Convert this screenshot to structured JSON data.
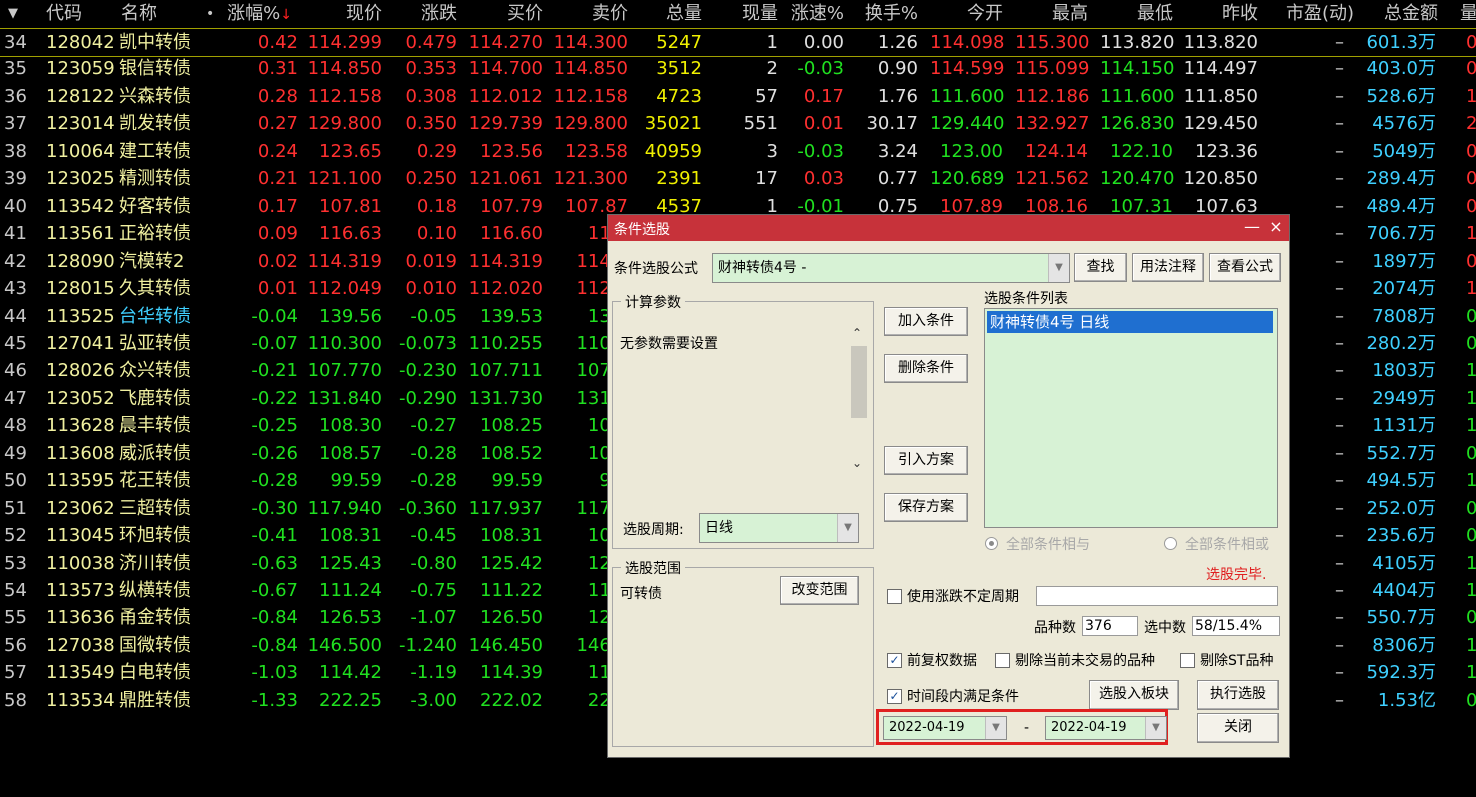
{
  "header": {
    "collapse_arrow": "▼",
    "code": "代码",
    "name": "名称",
    "dot": "•",
    "pct_change": "涨幅%",
    "sort_arrow": "↓",
    "price": "现价",
    "change": "涨跌",
    "bid": "买价",
    "ask": "卖价",
    "volume": "总量",
    "cur_volume": "现量",
    "speed": "涨速%",
    "turnover": "换手%",
    "open": "今开",
    "high": "最高",
    "low": "最低",
    "prev_close": "昨收",
    "pe": "市盈(动)",
    "amount": "总金额",
    "last_col": "量"
  },
  "rows": [
    {
      "idx": "34",
      "code": "128042",
      "name": "凯中转债",
      "pct": "0.42",
      "price": "114.299",
      "chg": "0.479",
      "bid": "114.270",
      "ask": "114.300",
      "vol": "5247",
      "cur": "1",
      "speed": "0.00",
      "turnover": "1.26",
      "open": "114.098",
      "high": "115.300",
      "low": "113.820",
      "prev": "113.820",
      "pe": "–",
      "amount": "601.3万",
      "tail": "0"
    },
    {
      "idx": "35",
      "code": "123059",
      "name": "银信转债",
      "pct": "0.31",
      "price": "114.850",
      "chg": "0.353",
      "bid": "114.700",
      "ask": "114.850",
      "vol": "3512",
      "cur": "2",
      "speed": "-0.03",
      "turnover": "0.90",
      "open": "114.599",
      "high": "115.099",
      "low": "114.150",
      "prev": "114.497",
      "pe": "–",
      "amount": "403.0万",
      "tail": "0"
    },
    {
      "idx": "36",
      "code": "128122",
      "name": "兴森转债",
      "pct": "0.28",
      "price": "112.158",
      "chg": "0.308",
      "bid": "112.012",
      "ask": "112.158",
      "vol": "4723",
      "cur": "57",
      "speed": "0.17",
      "turnover": "1.76",
      "open": "111.600",
      "high": "112.186",
      "low": "111.600",
      "prev": "111.850",
      "pe": "–",
      "amount": "528.6万",
      "tail": "1"
    },
    {
      "idx": "37",
      "code": "123014",
      "name": "凯发转债",
      "pct": "0.27",
      "price": "129.800",
      "chg": "0.350",
      "bid": "129.739",
      "ask": "129.800",
      "vol": "35021",
      "cur": "551",
      "speed": "0.01",
      "turnover": "30.17",
      "open": "129.440",
      "high": "132.927",
      "low": "126.830",
      "prev": "129.450",
      "pe": "–",
      "amount": "4576万",
      "tail": "2"
    },
    {
      "idx": "38",
      "code": "110064",
      "name": "建工转债",
      "pct": "0.24",
      "price": "123.65",
      "chg": "0.29",
      "bid": "123.56",
      "ask": "123.58",
      "vol": "40959",
      "cur": "3",
      "speed": "-0.03",
      "turnover": "3.24",
      "open": "123.00",
      "high": "124.14",
      "low": "122.10",
      "prev": "123.36",
      "pe": "–",
      "amount": "5049万",
      "tail": "0"
    },
    {
      "idx": "39",
      "code": "123025",
      "name": "精测转债",
      "pct": "0.21",
      "price": "121.100",
      "chg": "0.250",
      "bid": "121.061",
      "ask": "121.300",
      "vol": "2391",
      "cur": "17",
      "speed": "0.03",
      "turnover": "0.77",
      "open": "120.689",
      "high": "121.562",
      "low": "120.470",
      "prev": "120.850",
      "pe": "–",
      "amount": "289.4万",
      "tail": "0"
    },
    {
      "idx": "40",
      "code": "113542",
      "name": "好客转债",
      "pct": "0.17",
      "price": "107.81",
      "chg": "0.18",
      "bid": "107.79",
      "ask": "107.87",
      "vol": "4537",
      "cur": "1",
      "speed": "-0.01",
      "turnover": "0.75",
      "open": "107.89",
      "high": "108.16",
      "low": "107.31",
      "prev": "107.63",
      "pe": "–",
      "amount": "489.4万",
      "tail": "0"
    },
    {
      "idx": "41",
      "code": "113561",
      "name": "正裕转债",
      "pct": "0.09",
      "price": "116.63",
      "chg": "0.10",
      "bid": "116.60",
      "ask": "116.",
      "vol": "",
      "cur": "",
      "speed": "",
      "turnover": "",
      "open": "",
      "high": "",
      "low": "",
      "prev": "",
      "pe": "–",
      "amount": "706.7万",
      "tail": "1"
    },
    {
      "idx": "42",
      "code": "128090",
      "name": "汽模转2",
      "pct": "0.02",
      "price": "114.319",
      "chg": "0.019",
      "bid": "114.319",
      "ask": "114.3",
      "vol": "",
      "cur": "",
      "speed": "",
      "turnover": "",
      "open": "",
      "high": "",
      "low": "",
      "prev": "",
      "pe": "–",
      "amount": "1897万",
      "tail": "0"
    },
    {
      "idx": "43",
      "code": "128015",
      "name": "久其转债",
      "pct": "0.01",
      "price": "112.049",
      "chg": "0.010",
      "bid": "112.020",
      "ask": "112.0",
      "vol": "",
      "cur": "",
      "speed": "",
      "turnover": "",
      "open": "",
      "high": "",
      "low": "",
      "prev": "",
      "pe": "–",
      "amount": "2074万",
      "tail": "1"
    },
    {
      "idx": "44",
      "code": "113525",
      "name": "台华转债",
      "pct": "-0.04",
      "price": "139.56",
      "chg": "-0.05",
      "bid": "139.53",
      "ask": "139.",
      "vol": "",
      "cur": "",
      "speed": "",
      "turnover": "",
      "open": "",
      "high": "",
      "low": "",
      "prev": "",
      "pe": "–",
      "amount": "7808万",
      "tail": "0"
    },
    {
      "idx": "45",
      "code": "127041",
      "name": "弘亚转债",
      "pct": "-0.07",
      "price": "110.300",
      "chg": "-0.073",
      "bid": "110.255",
      "ask": "110.3",
      "vol": "",
      "cur": "",
      "speed": "",
      "turnover": "",
      "open": "",
      "high": "",
      "low": "",
      "prev": "",
      "pe": "–",
      "amount": "280.2万",
      "tail": "0"
    },
    {
      "idx": "46",
      "code": "128026",
      "name": "众兴转债",
      "pct": "-0.21",
      "price": "107.770",
      "chg": "-0.230",
      "bid": "107.711",
      "ask": "107.7",
      "vol": "",
      "cur": "",
      "speed": "",
      "turnover": "",
      "open": "",
      "high": "",
      "low": "",
      "prev": "",
      "pe": "–",
      "amount": "1803万",
      "tail": "1"
    },
    {
      "idx": "47",
      "code": "123052",
      "name": "飞鹿转债",
      "pct": "-0.22",
      "price": "131.840",
      "chg": "-0.290",
      "bid": "131.730",
      "ask": "131.8",
      "vol": "",
      "cur": "",
      "speed": "",
      "turnover": "",
      "open": "",
      "high": "",
      "low": "",
      "prev": "",
      "pe": "–",
      "amount": "2949万",
      "tail": "1"
    },
    {
      "idx": "48",
      "code": "113628",
      "name": "晨丰转债",
      "pct": "-0.25",
      "price": "108.30",
      "chg": "-0.27",
      "bid": "108.25",
      "ask": "108.",
      "vol": "",
      "cur": "",
      "speed": "",
      "turnover": "",
      "open": "",
      "high": "",
      "low": "",
      "prev": "",
      "pe": "–",
      "amount": "1131万",
      "tail": "1"
    },
    {
      "idx": "49",
      "code": "113608",
      "name": "威派转债",
      "pct": "-0.26",
      "price": "108.57",
      "chg": "-0.28",
      "bid": "108.52",
      "ask": "108.",
      "vol": "",
      "cur": "",
      "speed": "",
      "turnover": "",
      "open": "",
      "high": "",
      "low": "",
      "prev": "",
      "pe": "–",
      "amount": "552.7万",
      "tail": "0"
    },
    {
      "idx": "50",
      "code": "113595",
      "name": "花王转债",
      "pct": "-0.28",
      "price": "99.59",
      "chg": "-0.28",
      "bid": "99.59",
      "ask": "99.",
      "vol": "",
      "cur": "",
      "speed": "",
      "turnover": "",
      "open": "",
      "high": "",
      "low": "",
      "prev": "",
      "pe": "–",
      "amount": "494.5万",
      "tail": "1"
    },
    {
      "idx": "51",
      "code": "123062",
      "name": "三超转债",
      "pct": "-0.30",
      "price": "117.940",
      "chg": "-0.360",
      "bid": "117.937",
      "ask": "117.9",
      "vol": "",
      "cur": "",
      "speed": "",
      "turnover": "",
      "open": "",
      "high": "",
      "low": "",
      "prev": "",
      "pe": "–",
      "amount": "252.0万",
      "tail": "0"
    },
    {
      "idx": "52",
      "code": "113045",
      "name": "环旭转债",
      "pct": "-0.41",
      "price": "108.31",
      "chg": "-0.45",
      "bid": "108.31",
      "ask": "108.",
      "vol": "",
      "cur": "",
      "speed": "",
      "turnover": "",
      "open": "",
      "high": "",
      "low": "",
      "prev": "",
      "pe": "–",
      "amount": "235.6万",
      "tail": "0"
    },
    {
      "idx": "53",
      "code": "110038",
      "name": "济川转债",
      "pct": "-0.63",
      "price": "125.43",
      "chg": "-0.80",
      "bid": "125.42",
      "ask": "125.",
      "vol": "",
      "cur": "",
      "speed": "",
      "turnover": "",
      "open": "",
      "high": "",
      "low": "",
      "prev": "",
      "pe": "–",
      "amount": "4105万",
      "tail": "1"
    },
    {
      "idx": "54",
      "code": "113573",
      "name": "纵横转债",
      "pct": "-0.67",
      "price": "111.24",
      "chg": "-0.75",
      "bid": "111.22",
      "ask": "111.",
      "vol": "",
      "cur": "",
      "speed": "",
      "turnover": "",
      "open": "",
      "high": "",
      "low": "",
      "prev": "",
      "pe": "–",
      "amount": "4404万",
      "tail": "1"
    },
    {
      "idx": "55",
      "code": "113636",
      "name": "甬金转债",
      "pct": "-0.84",
      "price": "126.53",
      "chg": "-1.07",
      "bid": "126.50",
      "ask": "126.",
      "vol": "",
      "cur": "",
      "speed": "",
      "turnover": "",
      "open": "",
      "high": "",
      "low": "",
      "prev": "",
      "pe": "–",
      "amount": "550.7万",
      "tail": "0"
    },
    {
      "idx": "56",
      "code": "127038",
      "name": "国微转债",
      "pct": "-0.84",
      "price": "146.500",
      "chg": "-1.240",
      "bid": "146.450",
      "ask": "146.5",
      "vol": "",
      "cur": "",
      "speed": "",
      "turnover": "",
      "open": "",
      "high": "",
      "low": "",
      "prev": "",
      "pe": "–",
      "amount": "8306万",
      "tail": "1"
    },
    {
      "idx": "57",
      "code": "113549",
      "name": "白电转债",
      "pct": "-1.03",
      "price": "114.42",
      "chg": "-1.19",
      "bid": "114.39",
      "ask": "114.",
      "vol": "",
      "cur": "",
      "speed": "",
      "turnover": "",
      "open": "",
      "high": "",
      "low": "",
      "prev": "",
      "pe": "–",
      "amount": "592.3万",
      "tail": "1"
    },
    {
      "idx": "58",
      "code": "113534",
      "name": "鼎胜转债",
      "pct": "-1.33",
      "price": "222.25",
      "chg": "-3.00",
      "bid": "222.02",
      "ask": "222.",
      "vol": "",
      "cur": "",
      "speed": "",
      "turnover": "",
      "open": "",
      "high": "",
      "low": "",
      "prev": "",
      "pe": "–",
      "amount": "1.53亿",
      "tail": "0"
    }
  ],
  "dialog": {
    "title": "条件选股",
    "min_btn": "—",
    "close_btn": "×",
    "formula_label": "条件选股公式",
    "formula_value": "财神转债4号",
    "formula_dash": "-",
    "find_btn": "查找",
    "usage_btn": "用法注释",
    "view_formula_btn": "查看公式",
    "calc_params_caption": "计算参数",
    "no_params_text": "无参数需要设置",
    "period_label": "选股周期:",
    "period_value": "日线",
    "add_cond_btn": "加入条件",
    "del_cond_btn": "删除条件",
    "import_plan_btn": "引入方案",
    "save_plan_btn": "保存方案",
    "cond_list_label": "选股条件列表",
    "cond_item": "财神转债4号  日线",
    "and_label": "全部条件相与",
    "or_label": "全部条件相或",
    "status_text": "选股完毕.",
    "range_caption": "选股范围",
    "range_value": "可转债",
    "change_range_btn": "改变范围",
    "use_period_label": "使用涨跌不定周期",
    "count_label": "品种数",
    "count_value": "376",
    "selected_label": "选中数",
    "selected_value": "58/15.4%",
    "fq_label": "前复权数据",
    "exclude_notrade_label": "剔除当前未交易的品种",
    "exclude_st_label": "剔除ST品种",
    "time_range_label": "时间段内满足条件",
    "to_block_btn": "选股入板块",
    "exec_btn": "执行选股",
    "date_from": "2022-04-19",
    "date_sep": "-",
    "date_to": "2022-04-19",
    "close_dialog_btn": "关闭",
    "check_mark": "✓"
  },
  "colors": {
    "up": "#ff3030",
    "down": "#20e020",
    "title_bar": "#c7323a",
    "combo_bg": "#d7f2d5",
    "highlight_border": "#e02020",
    "list_selected": "#1f6fd0"
  }
}
